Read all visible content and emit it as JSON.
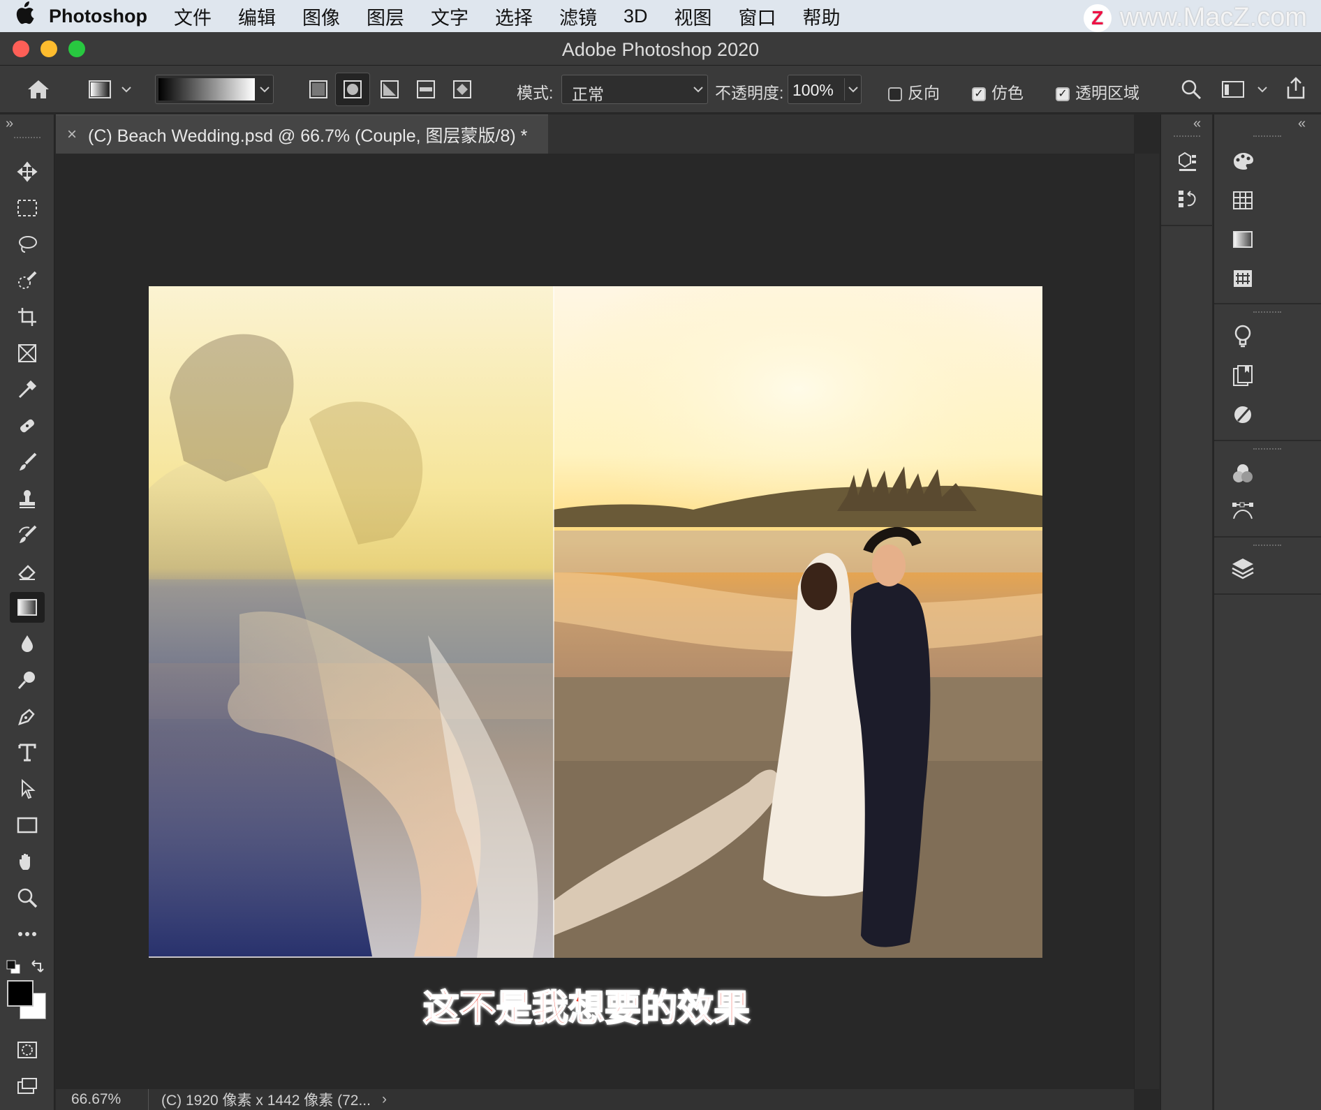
{
  "menubar": {
    "apple": "",
    "app_name": "Photoshop",
    "items": [
      "文件",
      "编辑",
      "图像",
      "图层",
      "文字",
      "选择",
      "滤镜",
      "3D",
      "视图",
      "窗口",
      "帮助"
    ],
    "watermark": "www.MacZ.com",
    "watermark_logo": "Z"
  },
  "window": {
    "title": "Adobe Photoshop 2020"
  },
  "options": {
    "mode_label": "模式:",
    "mode_value": "正常",
    "opacity_label": "不透明度:",
    "opacity_value": "100%",
    "reverse_label": "反向",
    "reverse_checked": false,
    "dither_label": "仿色",
    "dither_checked": true,
    "transparency_label": "透明区域",
    "transparency_checked": true
  },
  "document": {
    "tab_title": "(C) Beach Wedding.psd @ 66.7% (Couple, 图层蒙版/8) *",
    "close_glyph": "×"
  },
  "subtitle": "这不是我想要的效果",
  "statusbar": {
    "zoom": "66.67%",
    "info": "(C) 1920 像素 x 1442 像素 (72...",
    "arrow": "›"
  },
  "panel_collapse": {
    "left": "»",
    "right": "«"
  },
  "colors": {
    "accent_red": "#f04030",
    "chrome": "#3a3a3a",
    "canvas_bg": "#282828"
  }
}
